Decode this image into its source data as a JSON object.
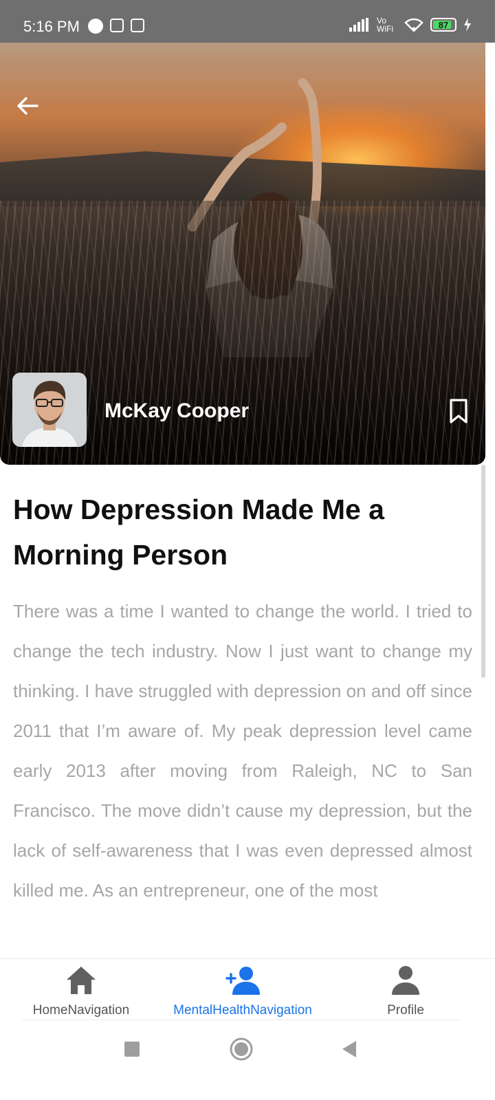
{
  "status_bar": {
    "time": "5:16 PM",
    "network": "Vo WiFi",
    "battery": "87",
    "battery_level": 0.87
  },
  "hero": {
    "back_icon": "arrow-left-icon",
    "author_name": "McKay Cooper",
    "bookmark_icon": "bookmark-icon"
  },
  "article": {
    "title": "How Depression Made Me a Morning Person",
    "body": "There was a time I wanted to change the world. I tried to change the tech industry. Now I just want to change my thinking. I have struggled with depression on and off since 2011 that I’m aware of. My peak depression level came early 2013 after moving from Raleigh, NC to San Francisco. The move didn’t cause my depression, but the lack of self-awareness that I was even depressed almost killed me. As an entrepreneur, one of the most"
  },
  "bottom_nav": {
    "items": [
      {
        "label": "HomeNavigation",
        "icon": "home-icon",
        "active": false
      },
      {
        "label": "MentalHealthNavigation",
        "icon": "add-person-icon",
        "active": true
      },
      {
        "label": "Profile",
        "icon": "person-icon",
        "active": false
      }
    ],
    "active_color": "#1a73e8",
    "inactive_color": "#555555"
  },
  "system_nav": {
    "buttons": [
      "recents-icon",
      "home-circle-icon",
      "back-triangle-icon"
    ]
  }
}
